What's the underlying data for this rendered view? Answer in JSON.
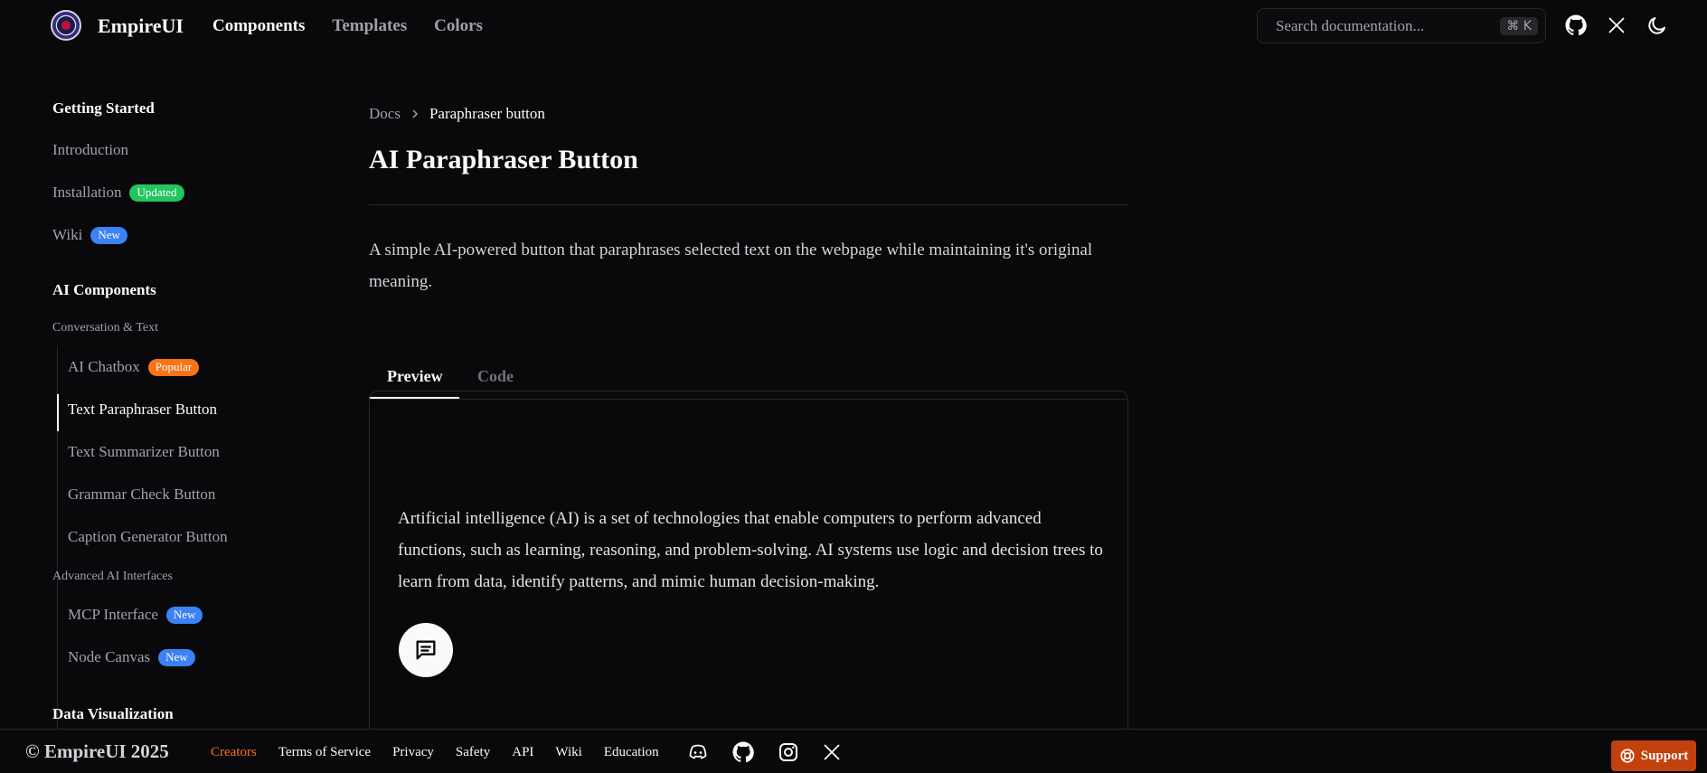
{
  "header": {
    "brand": "EmpireUI",
    "nav": [
      "Components",
      "Templates",
      "Colors"
    ],
    "search_placeholder": "Search documentation...",
    "shortcut": "⌘ K"
  },
  "sidebar": {
    "getting_started": {
      "title": "Getting Started",
      "items": [
        {
          "label": "Introduction"
        },
        {
          "label": "Installation",
          "badge": "Updated"
        },
        {
          "label": "Wiki",
          "badge": "New"
        }
      ]
    },
    "ai_components": {
      "title": "AI Components",
      "groups": [
        {
          "title": "Conversation & Text",
          "items": [
            {
              "label": "AI Chatbox",
              "badge": "Popular"
            },
            {
              "label": "Text Paraphraser Button"
            },
            {
              "label": "Text Summarizer Button"
            },
            {
              "label": "Grammar Check Button"
            },
            {
              "label": "Caption Generator Button"
            }
          ]
        },
        {
          "title": "Advanced AI Interfaces",
          "items": [
            {
              "label": "MCP Interface",
              "badge": "New"
            },
            {
              "label": "Node Canvas",
              "badge": "New"
            }
          ]
        }
      ]
    },
    "data_visualization": {
      "title": "Data Visualization"
    }
  },
  "main": {
    "breadcrumb": [
      "Docs",
      "Paraphraser button"
    ],
    "title": "AI Paraphraser Button",
    "description": "A simple AI-powered button that paraphrases selected text on the webpage while maintaining it's original meaning.",
    "tabs": [
      "Preview",
      "Code"
    ],
    "preview_text": "Artificial intelligence (AI) is a set of technologies that enable computers to perform advanced functions, such as learning, reasoning, and problem-solving. AI systems use logic and decision trees to learn from data, identify patterns, and mimic human decision-making."
  },
  "footer": {
    "copyright": "© EmpireUI 2025",
    "links": [
      "Creators",
      "Terms of Service",
      "Privacy",
      "Safety",
      "API",
      "Wiki",
      "Education"
    ],
    "support": "Support"
  },
  "colors": {
    "badge_updated": "#22c55e",
    "badge_new": "#3b82f6",
    "badge_popular": "#f97316",
    "accent": "#f97316",
    "support_bg": "#c2410c"
  },
  "icons": {
    "logo": "empireui-logo-icon",
    "github": "github-icon",
    "x": "x-icon",
    "theme": "moon-icon",
    "chat": "message-square-icon",
    "discord": "discord-icon",
    "instagram": "instagram-icon",
    "support": "lifebuoy-icon"
  }
}
